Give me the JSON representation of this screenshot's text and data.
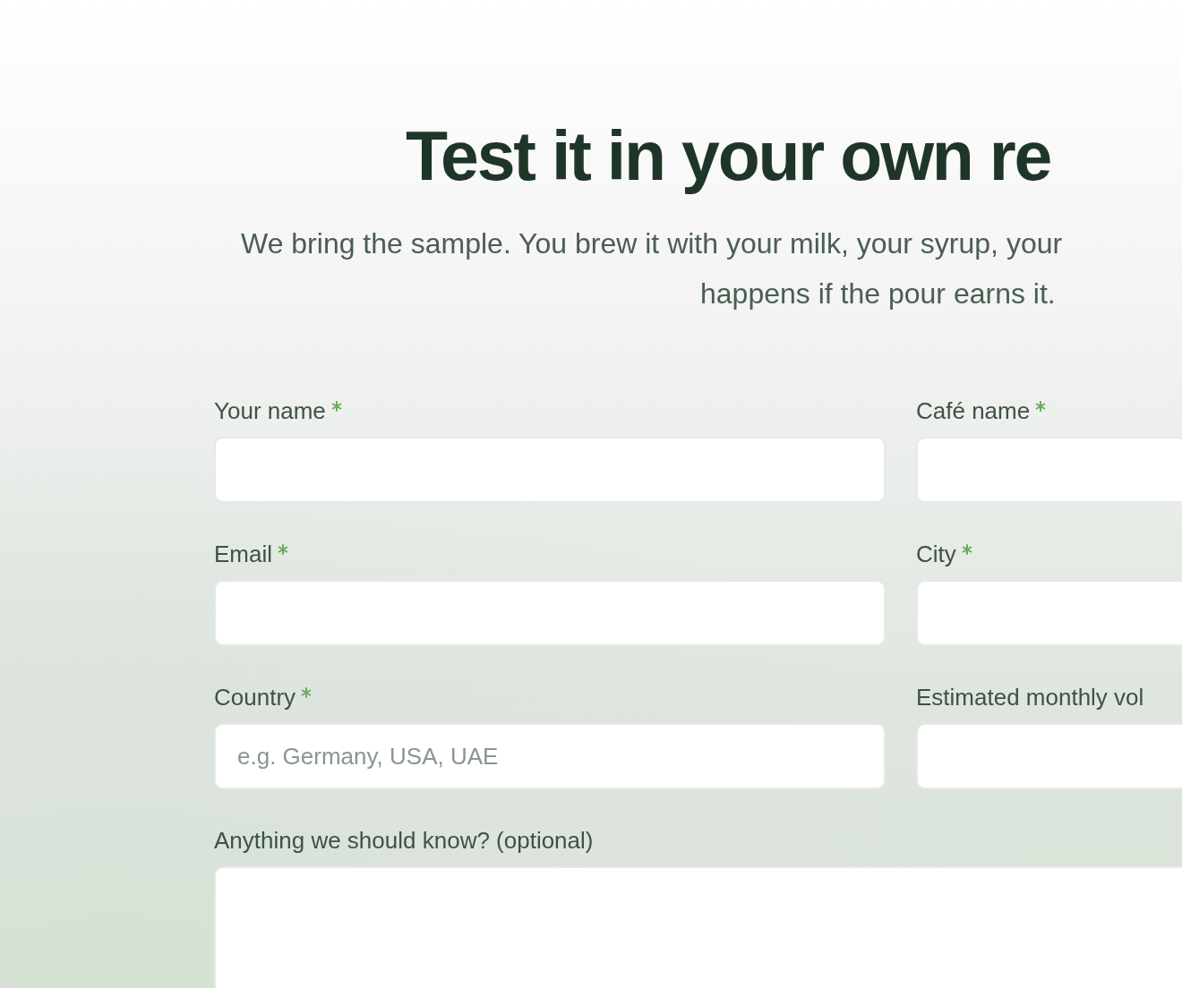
{
  "heading": "Test it in your own re",
  "subtitle_lines": [
    "We bring the sample. You brew it with your milk, your syrup, your",
    "happens if the pour earns it."
  ],
  "fields": [
    {
      "label": "Your name",
      "required": true
    },
    {
      "label": "Café name",
      "required": true
    },
    {
      "label": "Email",
      "required": true
    },
    {
      "label": "City",
      "required": true
    },
    {
      "label": "Country",
      "required": true,
      "placeholder": "e.g. Germany, USA, UAE"
    },
    {
      "label": "Estimated monthly vol"
    }
  ],
  "notes_field": {
    "label": "Anything we should know? (optional)"
  }
}
